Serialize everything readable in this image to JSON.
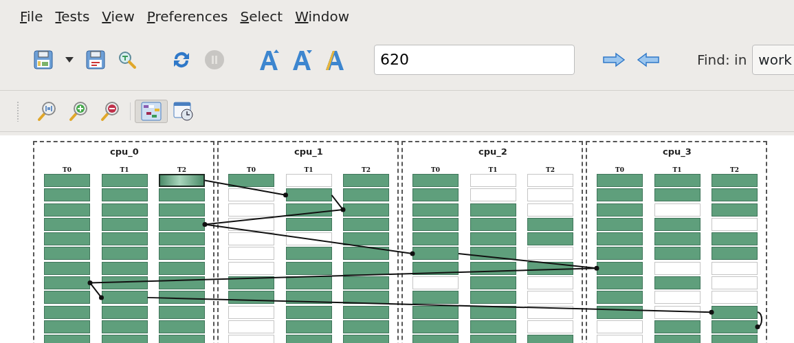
{
  "menu": [
    {
      "label": "File"
    },
    {
      "label": "Tests"
    },
    {
      "label": "View"
    },
    {
      "label": "Preferences"
    },
    {
      "label": "Select"
    },
    {
      "label": "Window"
    }
  ],
  "toolbar": {
    "pause_disabled": true,
    "zoom_value": "620",
    "find_label": "Find: in",
    "find_scope": "work"
  },
  "view_toggles": [
    {
      "kind": "grid",
      "selected": true
    },
    {
      "kind": "calendar",
      "selected": false
    }
  ],
  "cpus": [
    {
      "title": "cpu_0",
      "threads": [
        {
          "label": "T0",
          "cells": [
            {
              "filled": true,
              "selected": false
            },
            {
              "filled": true,
              "selected": false
            },
            {
              "filled": true,
              "selected": false
            },
            {
              "filled": true,
              "selected": false
            },
            {
              "filled": true,
              "selected": false
            },
            {
              "filled": true,
              "selected": false
            },
            {
              "filled": true,
              "selected": false
            },
            {
              "filled": true,
              "selected": false
            },
            {
              "filled": true,
              "selected": false
            },
            {
              "filled": true,
              "selected": false
            },
            {
              "filled": true,
              "selected": false
            },
            {
              "filled": true,
              "selected": false
            }
          ]
        },
        {
          "label": "T1",
          "cells": [
            {
              "filled": true,
              "selected": false
            },
            {
              "filled": true,
              "selected": false
            },
            {
              "filled": true,
              "selected": false
            },
            {
              "filled": true,
              "selected": false
            },
            {
              "filled": true,
              "selected": false
            },
            {
              "filled": true,
              "selected": false
            },
            {
              "filled": true,
              "selected": false
            },
            {
              "filled": true,
              "selected": false
            },
            {
              "filled": true,
              "selected": false
            },
            {
              "filled": true,
              "selected": false
            },
            {
              "filled": true,
              "selected": false
            },
            {
              "filled": true,
              "selected": false
            }
          ]
        },
        {
          "label": "T2",
          "cells": [
            {
              "filled": true,
              "selected": true
            },
            {
              "filled": true,
              "selected": false
            },
            {
              "filled": true,
              "selected": false
            },
            {
              "filled": true,
              "selected": false
            },
            {
              "filled": true,
              "selected": false
            },
            {
              "filled": true,
              "selected": false
            },
            {
              "filled": true,
              "selected": false
            },
            {
              "filled": true,
              "selected": false
            },
            {
              "filled": true,
              "selected": false
            },
            {
              "filled": true,
              "selected": false
            },
            {
              "filled": true,
              "selected": false
            },
            {
              "filled": true,
              "selected": false
            }
          ]
        }
      ]
    },
    {
      "title": "cpu_1",
      "threads": [
        {
          "label": "T0",
          "cells": [
            {
              "filled": true,
              "selected": false
            },
            {
              "filled": false,
              "selected": false
            },
            {
              "filled": false,
              "selected": false
            },
            {
              "filled": false,
              "selected": false
            },
            {
              "filled": false,
              "selected": false
            },
            {
              "filled": false,
              "selected": false
            },
            {
              "filled": false,
              "selected": false
            },
            {
              "filled": true,
              "selected": false
            },
            {
              "filled": true,
              "selected": false
            },
            {
              "filled": false,
              "selected": false
            },
            {
              "filled": false,
              "selected": false
            },
            {
              "filled": false,
              "selected": false
            }
          ]
        },
        {
          "label": "T1",
          "cells": [
            {
              "filled": false,
              "selected": false
            },
            {
              "filled": true,
              "selected": false
            },
            {
              "filled": true,
              "selected": false
            },
            {
              "filled": true,
              "selected": false
            },
            {
              "filled": false,
              "selected": false
            },
            {
              "filled": true,
              "selected": false
            },
            {
              "filled": true,
              "selected": false
            },
            {
              "filled": true,
              "selected": false
            },
            {
              "filled": true,
              "selected": false
            },
            {
              "filled": true,
              "selected": false
            },
            {
              "filled": true,
              "selected": false
            },
            {
              "filled": true,
              "selected": false
            }
          ]
        },
        {
          "label": "T2",
          "cells": [
            {
              "filled": true,
              "selected": false
            },
            {
              "filled": true,
              "selected": false
            },
            {
              "filled": true,
              "selected": false
            },
            {
              "filled": true,
              "selected": false
            },
            {
              "filled": true,
              "selected": false
            },
            {
              "filled": true,
              "selected": false
            },
            {
              "filled": true,
              "selected": false
            },
            {
              "filled": true,
              "selected": false
            },
            {
              "filled": true,
              "selected": false
            },
            {
              "filled": true,
              "selected": false
            },
            {
              "filled": true,
              "selected": false
            },
            {
              "filled": true,
              "selected": false
            }
          ]
        }
      ]
    },
    {
      "title": "cpu_2",
      "threads": [
        {
          "label": "T0",
          "cells": [
            {
              "filled": true,
              "selected": false
            },
            {
              "filled": true,
              "selected": false
            },
            {
              "filled": true,
              "selected": false
            },
            {
              "filled": true,
              "selected": false
            },
            {
              "filled": true,
              "selected": false
            },
            {
              "filled": true,
              "selected": false
            },
            {
              "filled": true,
              "selected": false
            },
            {
              "filled": false,
              "selected": false
            },
            {
              "filled": true,
              "selected": false
            },
            {
              "filled": true,
              "selected": false
            },
            {
              "filled": true,
              "selected": false
            },
            {
              "filled": true,
              "selected": false
            }
          ]
        },
        {
          "label": "T1",
          "cells": [
            {
              "filled": false,
              "selected": false
            },
            {
              "filled": false,
              "selected": false
            },
            {
              "filled": true,
              "selected": false
            },
            {
              "filled": true,
              "selected": false
            },
            {
              "filled": true,
              "selected": false
            },
            {
              "filled": true,
              "selected": false
            },
            {
              "filled": true,
              "selected": false
            },
            {
              "filled": true,
              "selected": false
            },
            {
              "filled": true,
              "selected": false
            },
            {
              "filled": true,
              "selected": false
            },
            {
              "filled": true,
              "selected": false
            },
            {
              "filled": true,
              "selected": false
            }
          ]
        },
        {
          "label": "T2",
          "cells": [
            {
              "filled": false,
              "selected": false
            },
            {
              "filled": false,
              "selected": false
            },
            {
              "filled": false,
              "selected": false
            },
            {
              "filled": true,
              "selected": false
            },
            {
              "filled": true,
              "selected": false
            },
            {
              "filled": false,
              "selected": false
            },
            {
              "filled": true,
              "selected": false
            },
            {
              "filled": false,
              "selected": false
            },
            {
              "filled": false,
              "selected": false
            },
            {
              "filled": false,
              "selected": false
            },
            {
              "filled": false,
              "selected": false
            },
            {
              "filled": true,
              "selected": false
            }
          ]
        }
      ]
    },
    {
      "title": "cpu_3",
      "threads": [
        {
          "label": "T0",
          "cells": [
            {
              "filled": true,
              "selected": false
            },
            {
              "filled": true,
              "selected": false
            },
            {
              "filled": true,
              "selected": false
            },
            {
              "filled": true,
              "selected": false
            },
            {
              "filled": true,
              "selected": false
            },
            {
              "filled": true,
              "selected": false
            },
            {
              "filled": true,
              "selected": false
            },
            {
              "filled": true,
              "selected": false
            },
            {
              "filled": true,
              "selected": false
            },
            {
              "filled": true,
              "selected": false
            },
            {
              "filled": false,
              "selected": false
            },
            {
              "filled": false,
              "selected": false
            }
          ]
        },
        {
          "label": "T1",
          "cells": [
            {
              "filled": true,
              "selected": false
            },
            {
              "filled": true,
              "selected": false
            },
            {
              "filled": false,
              "selected": false
            },
            {
              "filled": true,
              "selected": false
            },
            {
              "filled": true,
              "selected": false
            },
            {
              "filled": true,
              "selected": false
            },
            {
              "filled": false,
              "selected": false
            },
            {
              "filled": true,
              "selected": false
            },
            {
              "filled": false,
              "selected": false
            },
            {
              "filled": false,
              "selected": false
            },
            {
              "filled": true,
              "selected": false
            },
            {
              "filled": true,
              "selected": false
            }
          ]
        },
        {
          "label": "T2",
          "cells": [
            {
              "filled": true,
              "selected": false
            },
            {
              "filled": true,
              "selected": false
            },
            {
              "filled": true,
              "selected": false
            },
            {
              "filled": false,
              "selected": false
            },
            {
              "filled": true,
              "selected": false
            },
            {
              "filled": true,
              "selected": false
            },
            {
              "filled": false,
              "selected": false
            },
            {
              "filled": false,
              "selected": false
            },
            {
              "filled": false,
              "selected": false
            },
            {
              "filled": true,
              "selected": false
            },
            {
              "filled": true,
              "selected": false
            },
            {
              "filled": true,
              "selected": false
            }
          ]
        }
      ]
    }
  ]
}
